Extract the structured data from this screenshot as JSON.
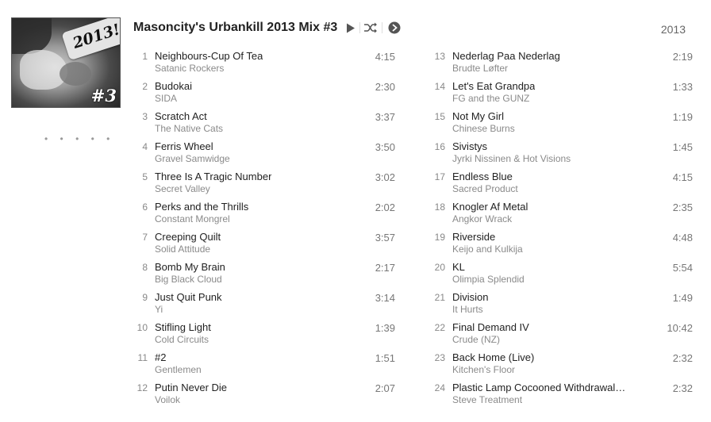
{
  "album": {
    "title": "Masoncity's Urbankill 2013 Mix #3",
    "year": "2013",
    "cover_stamp": "2013!",
    "cover_number": "#3",
    "dots": "• • • • •"
  },
  "controls": {
    "play_icon": "play-icon",
    "shuffle_icon": "shuffle-icon",
    "more_icon": "more-icon"
  },
  "tracks_left": [
    {
      "num": "1",
      "name": "Neighbours-Cup Of Tea",
      "artist": "Satanic Rockers",
      "duration": "4:15"
    },
    {
      "num": "2",
      "name": "Budokai",
      "artist": "SIDA",
      "duration": "2:30"
    },
    {
      "num": "3",
      "name": "Scratch Act",
      "artist": "The Native Cats",
      "duration": "3:37"
    },
    {
      "num": "4",
      "name": "Ferris Wheel",
      "artist": "Gravel Samwidge",
      "duration": "3:50"
    },
    {
      "num": "5",
      "name": "Three Is A Tragic Number",
      "artist": "Secret Valley",
      "duration": "3:02"
    },
    {
      "num": "6",
      "name": "Perks and the Thrills",
      "artist": "Constant Mongrel",
      "duration": "2:02"
    },
    {
      "num": "7",
      "name": "Creeping Quilt",
      "artist": "Solid Attitude",
      "duration": "3:57"
    },
    {
      "num": "8",
      "name": "Bomb My Brain",
      "artist": "Big Black Cloud",
      "duration": "2:17"
    },
    {
      "num": "9",
      "name": "Just Quit Punk",
      "artist": "Yi",
      "duration": "3:14"
    },
    {
      "num": "10",
      "name": "Stifling Light",
      "artist": "Cold Circuits",
      "duration": "1:39"
    },
    {
      "num": "11",
      "name": "#2",
      "artist": "Gentlemen",
      "duration": "1:51"
    },
    {
      "num": "12",
      "name": "Putin Never Die",
      "artist": "Voilok",
      "duration": "2:07"
    }
  ],
  "tracks_right": [
    {
      "num": "13",
      "name": "Nederlag Paa Nederlag",
      "artist": "Brudte Løfter",
      "duration": "2:19"
    },
    {
      "num": "14",
      "name": "Let's Eat Grandpa",
      "artist": "FG and the GUNZ",
      "duration": "1:33"
    },
    {
      "num": "15",
      "name": "Not My Girl",
      "artist": "Chinese Burns",
      "duration": "1:19"
    },
    {
      "num": "16",
      "name": "Sivistys",
      "artist": "Jyrki Nissinen & Hot Visions",
      "duration": "1:45"
    },
    {
      "num": "17",
      "name": "Endless Blue",
      "artist": "Sacred Product",
      "duration": "4:15"
    },
    {
      "num": "18",
      "name": "Knogler Af Metal",
      "artist": "Angkor Wrack",
      "duration": "2:35"
    },
    {
      "num": "19",
      "name": "Riverside",
      "artist": "Keijo and Kulkija",
      "duration": "4:48"
    },
    {
      "num": "20",
      "name": "KL",
      "artist": "Olimpia Splendid",
      "duration": "5:54"
    },
    {
      "num": "21",
      "name": "Division",
      "artist": "It Hurts",
      "duration": "1:49"
    },
    {
      "num": "22",
      "name": "Final Demand IV",
      "artist": "Crude (NZ)",
      "duration": "10:42"
    },
    {
      "num": "23",
      "name": "Back Home (Live)",
      "artist": "Kitchen's Floor",
      "duration": "2:32"
    },
    {
      "num": "24",
      "name": "Plastic Lamp Cocooned Withdrawal…",
      "artist": "Steve Treatment",
      "duration": "2:32"
    }
  ]
}
